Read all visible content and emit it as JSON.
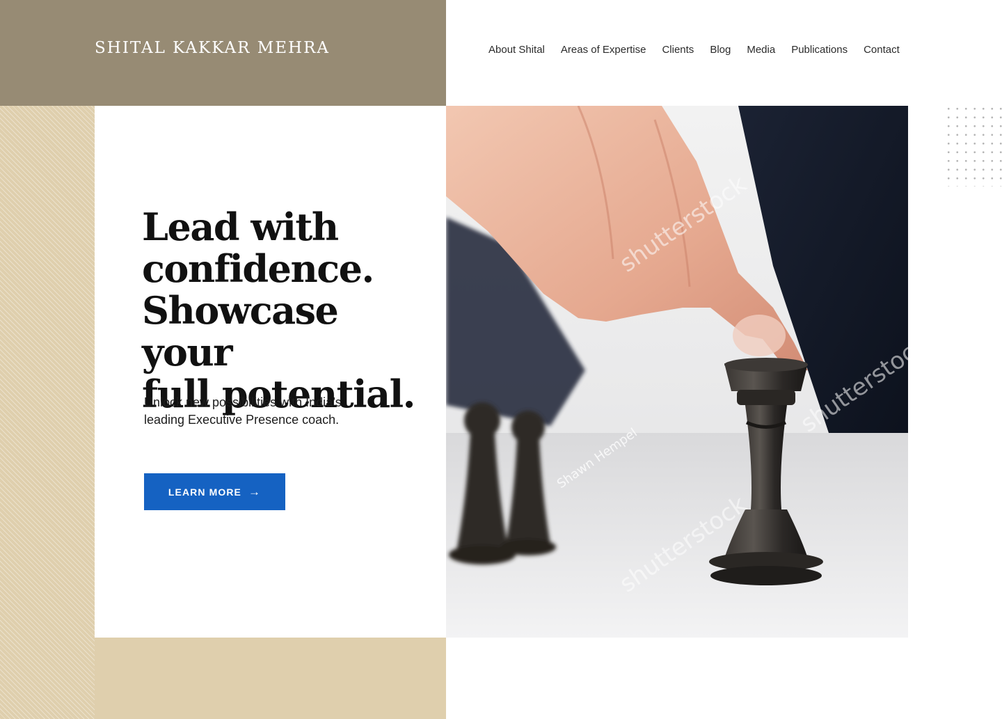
{
  "brand": {
    "name": "SHITAL KAKKAR MEHRA"
  },
  "nav": {
    "items": [
      {
        "label": "About Shital"
      },
      {
        "label": "Areas of Expertise"
      },
      {
        "label": "Clients"
      },
      {
        "label": "Blog"
      },
      {
        "label": "Media"
      },
      {
        "label": "Publications"
      },
      {
        "label": "Contact"
      }
    ]
  },
  "hero": {
    "headline_lines": [
      "Lead with",
      "confidence.",
      "Showcase your",
      "full potential."
    ],
    "subtext_lines": [
      "Unlock new possibilities with India’s",
      "leading Executive Presence coach."
    ],
    "cta_label": "LEARN MORE",
    "cta_icon": "arrow-right-icon"
  },
  "image": {
    "watermarks": [
      "shutterstock",
      "shutterstock",
      "shutterstock",
      "Shawn Hempel"
    ]
  },
  "colors": {
    "brand_block": "#978b74",
    "beige": "#dfcfad",
    "cta": "#1562c2",
    "text": "#111111"
  }
}
